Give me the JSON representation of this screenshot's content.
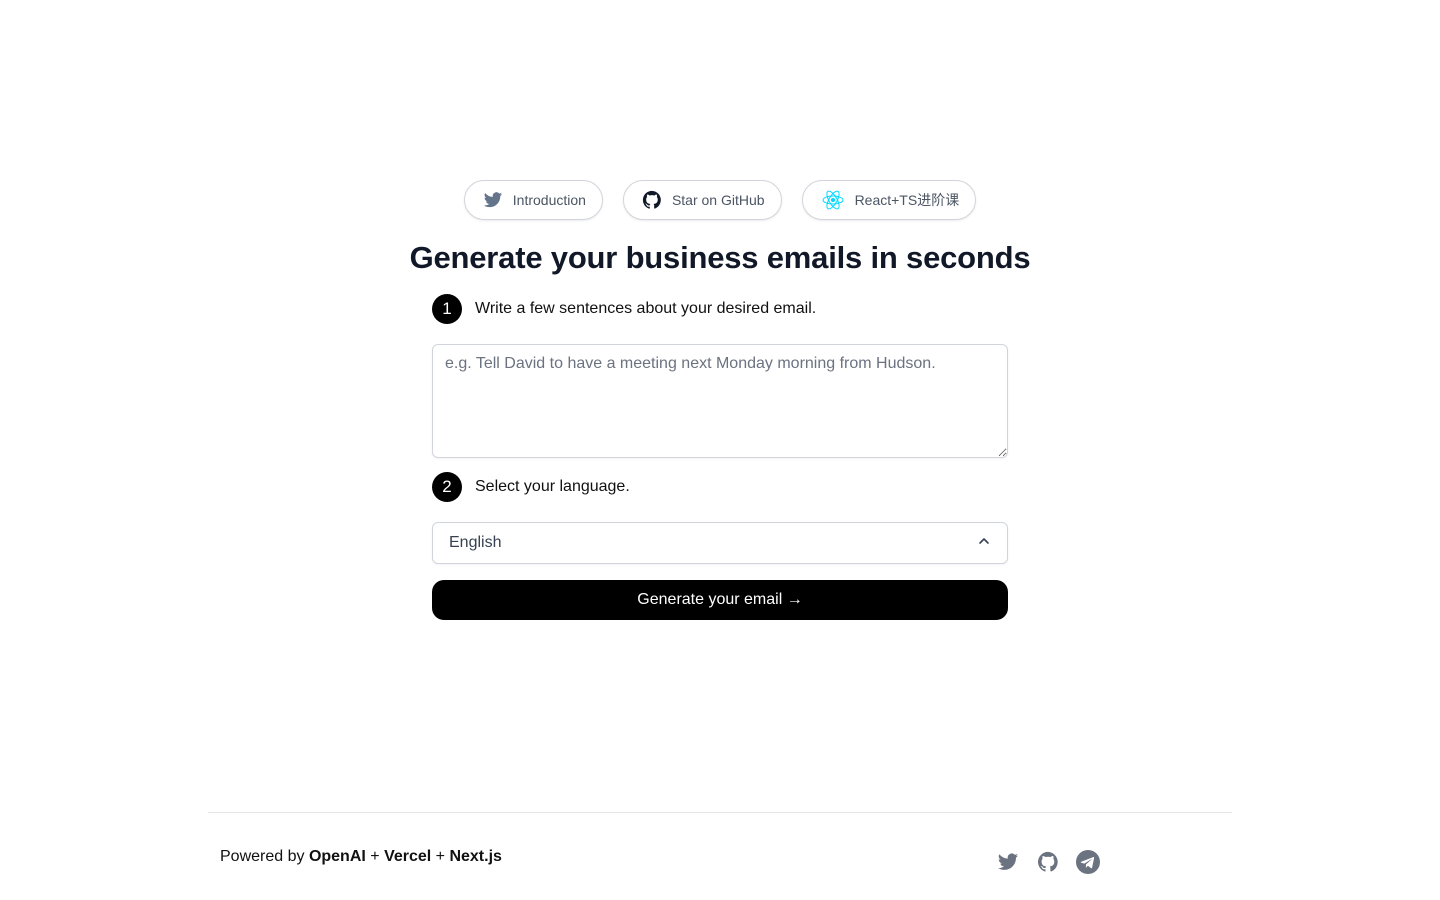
{
  "header": {
    "pills": [
      {
        "label": "Introduction",
        "icon": "twitter-icon"
      },
      {
        "label": "Star on GitHub",
        "icon": "github-icon"
      },
      {
        "label": "React+TS进阶课",
        "icon": "react-icon"
      }
    ]
  },
  "main": {
    "title": "Generate your business emails in seconds",
    "step1": {
      "number": "1",
      "label": "Write a few sentences about your desired email."
    },
    "prompt": {
      "value": "",
      "placeholder": "e.g. Tell David to have a meeting next Monday morning from Hudson."
    },
    "step2": {
      "number": "2",
      "label": "Select your language."
    },
    "language": {
      "selected": "English"
    },
    "generate_label": "Generate your email →"
  },
  "footer": {
    "powered_prefix": "Powered by ",
    "brand1": "OpenAI",
    "sep1": " + ",
    "brand2": "Vercel",
    "sep2": " + ",
    "brand3": "Next.js",
    "socials": [
      "twitter-icon",
      "github-icon",
      "telegram-icon"
    ]
  },
  "colors": {
    "accent": "#000000",
    "icon_gray": "#6b7280",
    "react": "#00d8ff",
    "twitter_pill": "#64748b"
  }
}
